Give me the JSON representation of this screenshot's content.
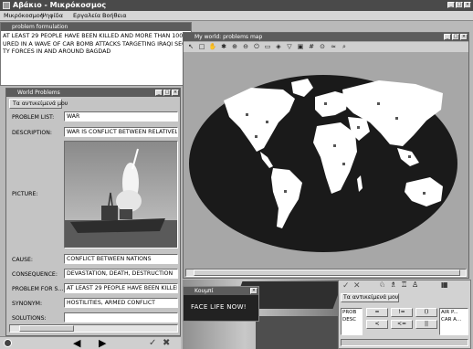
{
  "app": {
    "title": "Αβάκιο - Μικρόκοσμος",
    "menu": [
      "Μικρόκοσμος",
      "Ψηφίδα",
      "Εργαλεία",
      "Βοήθεια"
    ]
  },
  "colors": {
    "titlebar": "#5c5c5c",
    "ocean": "#1a1a1a",
    "land": "#ffffff",
    "panel": "#bdbdbd"
  },
  "problem_window": {
    "title": "problem formulation",
    "lines": [
      "AT LEAST 29 PEOPLE HAVE BEEN KILLED AND MORE THAN 100 II",
      "URED IN A WAVE OF CAR BOMB ATTACKS TARGETING IRAQI SECU",
      "TY FORCES IN AND AROUND BAGDAD"
    ]
  },
  "world_problems": {
    "title": "World Problems",
    "tab": "Τα αντικείμενά μου",
    "labels": {
      "problem_list": "PROBLEM LIST:",
      "description": "DESCRIPTION:",
      "picture": "PICTURE:",
      "cause": "CAUSE:",
      "consequence": "CONSEQUENCE:",
      "problem_for": "PROBLEM FOR S...",
      "synonym": "SYNONYM:",
      "solutions": "SOLUTIONS:"
    },
    "values": {
      "problem_list": "WAR",
      "description": "WAR IS CONFLICT BETWEEN RELATIVELY",
      "cause": "CONFLICT BETWEEN NATIONS",
      "consequence": "DEVASTATION, DEATH, DESTRUCTION",
      "problem_for": "AT LEAST 29 PEOPLE HAVE BEEN KILLED A",
      "synonym": "HOSTILITIES, ARMED CONFLICT",
      "solutions": ""
    }
  },
  "map_window": {
    "title": "My world: problems map",
    "toolbar_icons": [
      "arrow",
      "rect",
      "hand",
      "pin",
      "zoom-in",
      "zoom-out",
      "power",
      "ruler",
      "layers",
      "filter",
      "image",
      "grid",
      "zoom-target",
      "scale",
      "magnifier"
    ]
  },
  "slogan_window": {
    "title": "Κουμπί",
    "text": "FACE LIFE NOW!"
  },
  "bottom_panel": {
    "tab": "Τα αντικείμενά μου",
    "items": [
      "PROB",
      "DESC",
      "AIR P...",
      "CAR A..."
    ],
    "ops": [
      "=",
      "!=",
      "()",
      "<",
      "<=",
      "||"
    ]
  }
}
